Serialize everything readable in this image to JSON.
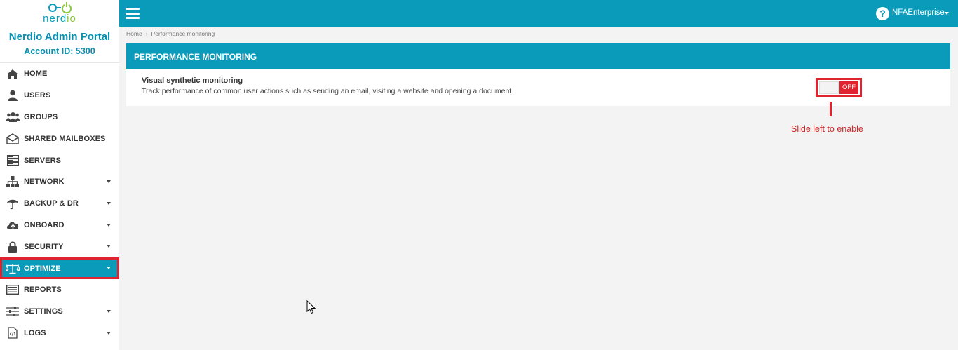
{
  "brand": {
    "logo_text_main": "nerd",
    "logo_text_accent": "io",
    "portal_name": "Nerdio Admin Portal",
    "account_id": "Account ID: 5300"
  },
  "sidebar": {
    "items": [
      {
        "label": "HOME",
        "icon": "home-icon",
        "has_caret": false
      },
      {
        "label": "USERS",
        "icon": "user-icon",
        "has_caret": false
      },
      {
        "label": "GROUPS",
        "icon": "group-icon",
        "has_caret": false
      },
      {
        "label": "SHARED MAILBOXES",
        "icon": "mailbox-icon",
        "has_caret": false
      },
      {
        "label": "SERVERS",
        "icon": "server-icon",
        "has_caret": false
      },
      {
        "label": "NETWORK",
        "icon": "network-icon",
        "has_caret": true
      },
      {
        "label": "BACKUP & DR",
        "icon": "umbrella-icon",
        "has_caret": true
      },
      {
        "label": "ONBOARD",
        "icon": "cloud-upload-icon",
        "has_caret": true
      },
      {
        "label": "SECURITY",
        "icon": "lock-icon",
        "has_caret": true
      },
      {
        "label": "OPTIMIZE",
        "icon": "scale-icon",
        "has_caret": true,
        "active": true
      },
      {
        "label": "REPORTS",
        "icon": "report-icon",
        "has_caret": false
      },
      {
        "label": "SETTINGS",
        "icon": "sliders-icon",
        "has_caret": true
      },
      {
        "label": "LOGS",
        "icon": "code-file-icon",
        "has_caret": true
      }
    ]
  },
  "topbar": {
    "help_glyph": "?",
    "user_name": "NFAEnterprise"
  },
  "breadcrumb": {
    "home": "Home",
    "separator": "›",
    "current": "Performance monitoring"
  },
  "panel": {
    "title": "PERFORMANCE MONITORING",
    "setting_title": "Visual synthetic monitoring",
    "setting_description": "Track performance of common user actions such as sending an email, visiting a website and opening a document.",
    "toggle_state": "OFF"
  },
  "annotation": {
    "callout_text": "Slide left to enable"
  },
  "colors": {
    "accent": "#0a9bbb",
    "highlight": "#e0242f",
    "logo_green": "#8cc63f"
  }
}
